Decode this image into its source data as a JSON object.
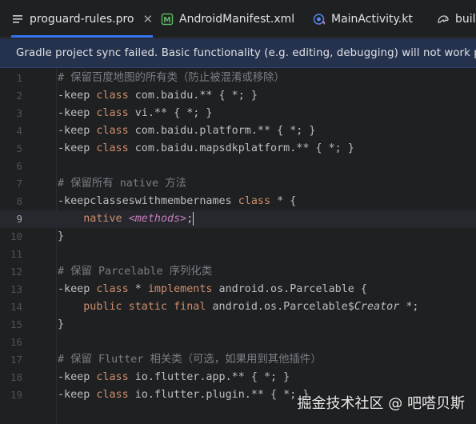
{
  "tabs": [
    {
      "label": "proguard-rules.pro",
      "icon": "file-lines-icon",
      "active": true,
      "closable": true
    },
    {
      "label": "AndroidManifest.xml",
      "icon": "manifest-icon",
      "active": false,
      "closable": false
    },
    {
      "label": "MainActivity.kt",
      "icon": "kotlin-activity-icon",
      "active": false,
      "closable": false
    },
    {
      "label": "build",
      "icon": "gradle-build-icon",
      "active": false,
      "closable": false
    }
  ],
  "banner": {
    "text": "Gradle project sync failed. Basic functionality (e.g. editing, debugging) will not work properly."
  },
  "editor": {
    "current_line": 9,
    "lines": [
      {
        "n": "1",
        "tokens": [
          {
            "t": "# 保留百度地图的所有类（防止被混淆或移除）",
            "c": "comment"
          }
        ]
      },
      {
        "n": "2",
        "tokens": [
          {
            "t": "-keep ",
            "c": "plain"
          },
          {
            "t": "class",
            "c": "kw"
          },
          {
            "t": " com.baidu.** { *; }",
            "c": "plain"
          }
        ]
      },
      {
        "n": "3",
        "tokens": [
          {
            "t": "-keep ",
            "c": "plain"
          },
          {
            "t": "class",
            "c": "kw"
          },
          {
            "t": " vi.** { *; }",
            "c": "plain"
          }
        ]
      },
      {
        "n": "4",
        "tokens": [
          {
            "t": "-keep ",
            "c": "plain"
          },
          {
            "t": "class",
            "c": "kw"
          },
          {
            "t": " com.baidu.platform.** { *; }",
            "c": "plain"
          }
        ]
      },
      {
        "n": "5",
        "tokens": [
          {
            "t": "-keep ",
            "c": "plain"
          },
          {
            "t": "class",
            "c": "kw"
          },
          {
            "t": " com.baidu.mapsdkplatform.** { *; }",
            "c": "plain"
          }
        ]
      },
      {
        "n": "6",
        "tokens": []
      },
      {
        "n": "7",
        "tokens": [
          {
            "t": "# 保留所有 native 方法",
            "c": "comment"
          }
        ]
      },
      {
        "n": "8",
        "tokens": [
          {
            "t": "-keepclasseswithmembernames ",
            "c": "plain"
          },
          {
            "t": "class",
            "c": "kw"
          },
          {
            "t": " * {",
            "c": "plain"
          }
        ]
      },
      {
        "n": "9",
        "tokens": [
          {
            "t": "    ",
            "c": "plain"
          },
          {
            "t": "native",
            "c": "kw"
          },
          {
            "t": " ",
            "c": "plain"
          },
          {
            "t": "<methods>",
            "c": "tag"
          },
          {
            "t": ";",
            "c": "plain"
          }
        ],
        "caret": true
      },
      {
        "n": "10",
        "tokens": [
          {
            "t": "}",
            "c": "plain"
          }
        ]
      },
      {
        "n": "11",
        "tokens": []
      },
      {
        "n": "12",
        "tokens": [
          {
            "t": "# 保留 Parcelable 序列化类",
            "c": "comment"
          }
        ]
      },
      {
        "n": "13",
        "tokens": [
          {
            "t": "-keep ",
            "c": "plain"
          },
          {
            "t": "class",
            "c": "kw"
          },
          {
            "t": " * ",
            "c": "plain"
          },
          {
            "t": "implements",
            "c": "kw"
          },
          {
            "t": " android.os.Parcelable {",
            "c": "plain"
          }
        ]
      },
      {
        "n": "14",
        "tokens": [
          {
            "t": "    ",
            "c": "plain"
          },
          {
            "t": "public static final",
            "c": "kw"
          },
          {
            "t": " android.os.Parcelable$",
            "c": "plain"
          },
          {
            "t": "Creator",
            "c": "str"
          },
          {
            "t": " *;",
            "c": "plain"
          }
        ]
      },
      {
        "n": "15",
        "tokens": [
          {
            "t": "}",
            "c": "plain"
          }
        ]
      },
      {
        "n": "16",
        "tokens": []
      },
      {
        "n": "17",
        "tokens": [
          {
            "t": "# 保留 Flutter 相关类（可选，如果用到其他插件）",
            "c": "comment"
          }
        ]
      },
      {
        "n": "18",
        "tokens": [
          {
            "t": "-keep ",
            "c": "plain"
          },
          {
            "t": "class",
            "c": "kw"
          },
          {
            "t": " io.flutter.app.** { *; }",
            "c": "plain"
          }
        ]
      },
      {
        "n": "19",
        "tokens": [
          {
            "t": "-keep ",
            "c": "plain"
          },
          {
            "t": "class",
            "c": "kw"
          },
          {
            "t": " io.flutter.plugin.** { *; }",
            "c": "plain"
          }
        ]
      }
    ]
  },
  "watermark": {
    "text": "掘金技术社区 @ 吧嗒贝斯"
  },
  "colors": {
    "editor_bg": "#1f2022",
    "tab_underline": "#3574f0",
    "banner_bg": "#25324d",
    "keyword": "#cf8e6d",
    "comment": "#7a7e85",
    "tag": "#c77dbb",
    "text": "#bcbec4",
    "line_number": "#4e5157",
    "manifest_icon": "#5fb865",
    "kotlin_icon": "#548af7"
  }
}
